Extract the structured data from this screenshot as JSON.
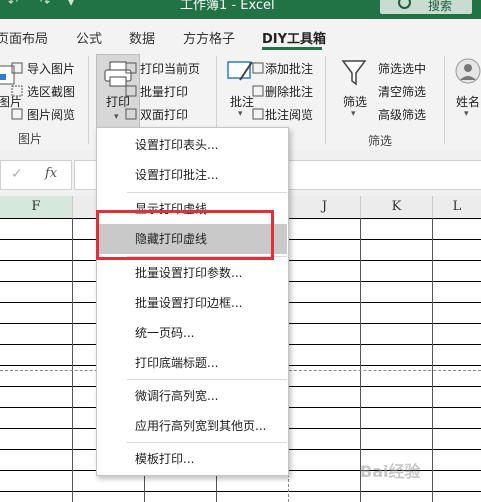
{
  "titlebar": {
    "doc_title": "工作簿1  -  Excel",
    "search_label": "搜索"
  },
  "tabs": [
    "页面布局",
    "公式",
    "数据",
    "方方格子",
    "DIY工具箱"
  ],
  "ribbon": {
    "left_partial_label": "图片",
    "image_buttons": [
      "导入图片",
      "选区截图",
      "图片阅览"
    ],
    "print_label": "打印",
    "print_buttons": [
      "打印当前页",
      "批量打印",
      "双面打印"
    ],
    "comment_label": "批注",
    "comment_buttons": [
      "添加批注",
      "删除批注",
      "批注阅览"
    ],
    "filter_label": "筛选",
    "filter_buttons": [
      "筛选选中",
      "清空筛选",
      "高级筛选"
    ],
    "name_label": "姓名",
    "group_labels": [
      "图片",
      "筛选"
    ]
  },
  "formula": {
    "cancel_icon": "✓",
    "fx": "fx"
  },
  "columns": [
    "F",
    "",
    "",
    "",
    "",
    "J",
    "K",
    "L"
  ],
  "menu_items": [
    "设置打印表头...",
    "设置打印批注...",
    "显示打印虚线",
    "隐藏打印虚线",
    "批量设置打印参数...",
    "批量设置打印边框...",
    "统一页码...",
    "打印底端标题...",
    "微调行高列宽...",
    "应用行高列宽到其他页...",
    "模板打印..."
  ],
  "watermark": "Bai经验",
  "accent_color": "#217346",
  "highlight_color": "#e0313b"
}
